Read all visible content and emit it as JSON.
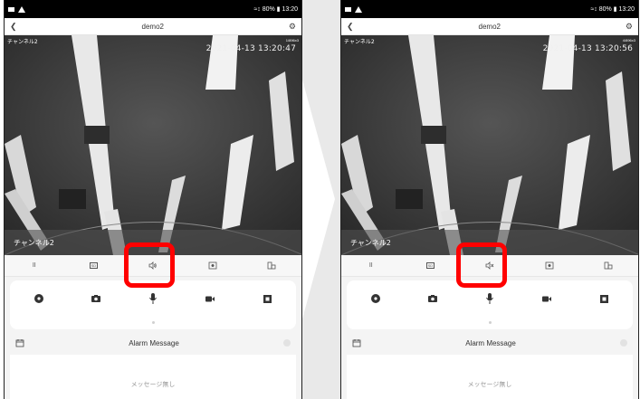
{
  "watermark_color": "#e9e9e9",
  "highlight_color": "#ff0000",
  "screens": [
    {
      "statusbar": {
        "right": "≈↕ 80% ▮ 13:20"
      },
      "navbar": {
        "title": "demo2"
      },
      "video": {
        "channel_name": "チャンネル2",
        "channel_small": "1/896x3",
        "timestamp": "2021-04-13 13:20:47",
        "overlay_text": "チャンネル2"
      },
      "controls": {
        "pause": "II",
        "quality": "SD",
        "speaker_state": "on"
      },
      "alarm": {
        "label": "Alarm Message",
        "empty_text": "メッセージ無し"
      }
    },
    {
      "statusbar": {
        "right": "≈↕ 80% ▮ 13:20"
      },
      "navbar": {
        "title": "demo2"
      },
      "video": {
        "channel_name": "チャンネル2",
        "channel_small": "4/896x3",
        "timestamp": "2021-04-13 13:20:56",
        "overlay_text": "チャンネル2"
      },
      "controls": {
        "pause": "II",
        "quality": "SD",
        "speaker_state": "muted"
      },
      "alarm": {
        "label": "Alarm Message",
        "empty_text": "メッセージ無し"
      }
    }
  ]
}
